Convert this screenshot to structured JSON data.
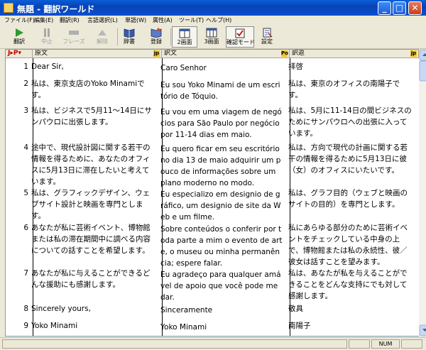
{
  "window": {
    "title": "無題 - 翻訳ワールド"
  },
  "menu": [
    "ファイル(F)",
    "編集(E)",
    "翻訳(R)",
    "言語選択(L)",
    "単語(W)",
    "属性(A)",
    "ツール(T)",
    "ヘルプ(H)"
  ],
  "toolbar": {
    "translate": "翻訳",
    "stop": "中止",
    "phrase": "フレーズ",
    "release": "解除",
    "dictionary": "辞書",
    "register": "登録",
    "two_pane": "2画面",
    "three_pane": "3画面",
    "confirm_mode": "確認モード",
    "settings": "設定"
  },
  "grid": {
    "lang_pair": "J▸P▾",
    "headers": {
      "source": "原文",
      "target": "訳文",
      "back": "訳返"
    },
    "header_icons": {
      "source": "jp",
      "target": "Po",
      "back": "jp"
    },
    "rows": [
      {
        "num": "1",
        "source": "Dear Sir,",
        "target": "Caro Senhor",
        "back": "拝啓"
      },
      {
        "num": "2",
        "source": "私は、東京支店のYoko Minamiです。",
        "target": "Eu sou Yoko Minami de um escritório de Tóquio.",
        "back": "私は、東京のオフィスの南陽子です。"
      },
      {
        "num": "3",
        "source": "私は、ビジネスで5月11～14日にサンパウロに出張します。",
        "target": "Eu vou em uma viagem de negócios para São Paulo por negócio por 11-14 dias em maio.",
        "back": "私は、5月に11-14日の間ビジネスのためにサンパウロへの出張に入っています。"
      },
      {
        "num": "4",
        "source": "途中で、現代設計図に関する若干の情報を得るために、あなたのオフィスに5月13日に滞在したいと考えています。",
        "target": "Eu quero ficar em seu escritório no dia 13 de maio adquirir um pouco de informações sobre um plano moderno no modo.",
        "back": "私は、方向で現代の計画に関する若干の情報を得るために5月13日に彼（女）のオフィスにいたいです。"
      },
      {
        "num": "5",
        "source": "私は、グラフィックデザイン、ウェブサイト設計と映画を専門とします。",
        "target": "Eu especializo em designio de gráfico, um designio de site da Web e um filme.",
        "back": "私は、グラフ目的（ウェブと映画のサイトの目的）を専門とします。"
      },
      {
        "num": "6",
        "source": "あなたが私に芸術イベント、博物館または私の滞在期間中に調べる内容についての話すことを希望します。",
        "target": "Sobre conteúdos o conferir por toda parte a mim o evento de arte, o museu ou minha permanência; espere falar.",
        "back": "私にあらゆる部分のために芸術イベントをチェックしている中身の上で、博物館または私の永続性、彼／彼女は話すことを望みます。"
      },
      {
        "num": "7",
        "source": "あなたが私に与えることができるどんな援助にも感謝します。",
        "target": "Eu agradeço para qualquer amável de apoio que você pode me dar.",
        "back": "私は、あなたが私を与えることができることをどんな支持にでも対して感謝します。"
      },
      {
        "num": "8",
        "source": "Sincerely yours,",
        "target": "Sinceramente",
        "back": "敬具"
      },
      {
        "num": "9",
        "source": "Yoko Minami",
        "target": "Yoko Minami",
        "back": "南陽子"
      }
    ]
  },
  "status": {
    "num": "NUM"
  },
  "colors": {
    "title_blue": "#0A4FD0",
    "grid_border": "#7F9DB9",
    "icon_yellow": "#F3C320"
  }
}
